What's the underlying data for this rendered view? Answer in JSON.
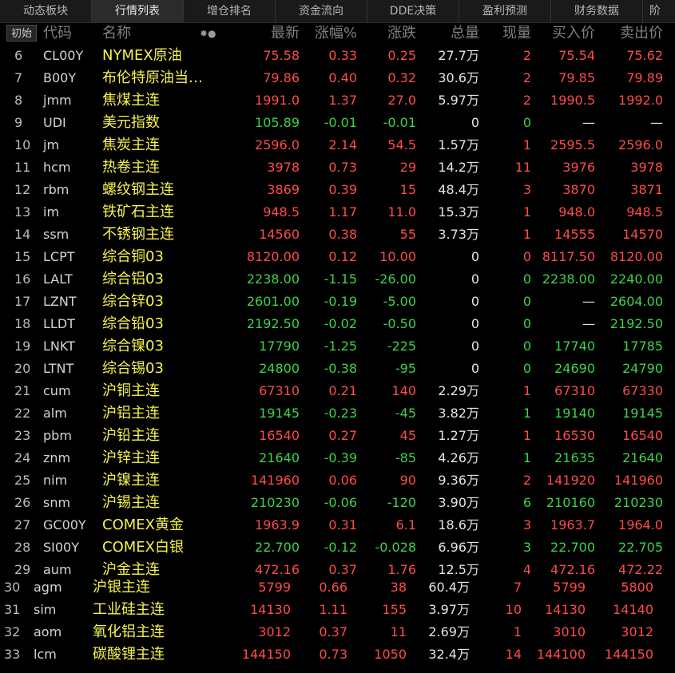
{
  "tabs": [
    "动态板块",
    "行情列表",
    "增仓排名",
    "资金流向",
    "DDE决策",
    "盈利预测",
    "财务数据",
    "阶"
  ],
  "active_tab": 1,
  "init_button": "初始",
  "columns": {
    "code": "代码",
    "name": "名称",
    "icons": "✸●",
    "last": "最新",
    "pct": "涨幅%",
    "change": "涨跌",
    "volume": "总量",
    "cur": "现量",
    "bid": "买入价",
    "ask": "卖出价"
  },
  "rows": [
    {
      "idx": "6",
      "code": "CL00Y",
      "name": "NYMEX原油",
      "last": "75.58",
      "pct": "0.33",
      "change": "0.25",
      "volume": "27.7万",
      "cur": "2",
      "bid": "75.54",
      "ask": "75.62",
      "dir": "red"
    },
    {
      "idx": "7",
      "code": "B00Y",
      "name": "布伦特原油当…",
      "last": "79.86",
      "pct": "0.40",
      "change": "0.32",
      "volume": "30.6万",
      "cur": "2",
      "bid": "79.85",
      "ask": "79.89",
      "dir": "red"
    },
    {
      "idx": "8",
      "code": "jmm",
      "name": "焦煤主连",
      "last": "1991.0",
      "pct": "1.37",
      "change": "27.0",
      "volume": "5.97万",
      "cur": "2",
      "bid": "1990.5",
      "ask": "1992.0",
      "dir": "red"
    },
    {
      "idx": "9",
      "code": "UDI",
      "name": "美元指数",
      "last": "105.89",
      "pct": "-0.01",
      "change": "-0.01",
      "volume": "0",
      "cur": "0",
      "bid": "—",
      "ask": "—",
      "dir": "green"
    },
    {
      "idx": "10",
      "code": "jm",
      "name": "焦炭主连",
      "last": "2596.0",
      "pct": "2.14",
      "change": "54.5",
      "volume": "1.57万",
      "cur": "1",
      "bid": "2595.5",
      "ask": "2596.0",
      "dir": "red"
    },
    {
      "idx": "11",
      "code": "hcm",
      "name": "热卷主连",
      "last": "3978",
      "pct": "0.73",
      "change": "29",
      "volume": "14.2万",
      "cur": "11",
      "bid": "3976",
      "ask": "3978",
      "dir": "red"
    },
    {
      "idx": "12",
      "code": "rbm",
      "name": "螺纹钢主连",
      "last": "3869",
      "pct": "0.39",
      "change": "15",
      "volume": "48.4万",
      "cur": "3",
      "bid": "3870",
      "ask": "3871",
      "dir": "red"
    },
    {
      "idx": "13",
      "code": "im",
      "name": "铁矿石主连",
      "last": "948.5",
      "pct": "1.17",
      "change": "11.0",
      "volume": "15.3万",
      "cur": "1",
      "bid": "948.0",
      "ask": "948.5",
      "dir": "red"
    },
    {
      "idx": "14",
      "code": "ssm",
      "name": "不锈钢主连",
      "last": "14560",
      "pct": "0.38",
      "change": "55",
      "volume": "3.73万",
      "cur": "1",
      "bid": "14555",
      "ask": "14570",
      "dir": "red"
    },
    {
      "idx": "15",
      "code": "LCPT",
      "name": "综合铜03",
      "last": "8120.00",
      "pct": "0.12",
      "change": "10.00",
      "volume": "0",
      "cur": "0",
      "bid": "8117.50",
      "ask": "8120.00",
      "dir": "red"
    },
    {
      "idx": "16",
      "code": "LALT",
      "name": "综合铝03",
      "last": "2238.00",
      "pct": "-1.15",
      "change": "-26.00",
      "volume": "0",
      "cur": "0",
      "bid": "2238.00",
      "ask": "2240.00",
      "dir": "green"
    },
    {
      "idx": "17",
      "code": "LZNT",
      "name": "综合锌03",
      "last": "2601.00",
      "pct": "-0.19",
      "change": "-5.00",
      "volume": "0",
      "cur": "0",
      "bid": "—",
      "ask": "2604.00",
      "dir": "green"
    },
    {
      "idx": "18",
      "code": "LLDT",
      "name": "综合铅03",
      "last": "2192.50",
      "pct": "-0.02",
      "change": "-0.50",
      "volume": "0",
      "cur": "0",
      "bid": "—",
      "ask": "2192.50",
      "dir": "green"
    },
    {
      "idx": "19",
      "code": "LNKT",
      "name": "综合镍03",
      "last": "17790",
      "pct": "-1.25",
      "change": "-225",
      "volume": "0",
      "cur": "0",
      "bid": "17740",
      "ask": "17785",
      "dir": "green"
    },
    {
      "idx": "20",
      "code": "LTNT",
      "name": "综合锡03",
      "last": "24800",
      "pct": "-0.38",
      "change": "-95",
      "volume": "0",
      "cur": "0",
      "bid": "24690",
      "ask": "24790",
      "dir": "green"
    },
    {
      "idx": "21",
      "code": "cum",
      "name": "沪铜主连",
      "last": "67310",
      "pct": "0.21",
      "change": "140",
      "volume": "2.29万",
      "cur": "1",
      "bid": "67310",
      "ask": "67330",
      "dir": "red"
    },
    {
      "idx": "22",
      "code": "alm",
      "name": "沪铝主连",
      "last": "19145",
      "pct": "-0.23",
      "change": "-45",
      "volume": "3.82万",
      "cur": "1",
      "bid": "19140",
      "ask": "19145",
      "dir": "green"
    },
    {
      "idx": "23",
      "code": "pbm",
      "name": "沪铅主连",
      "last": "16540",
      "pct": "0.27",
      "change": "45",
      "volume": "1.27万",
      "cur": "1",
      "bid": "16530",
      "ask": "16540",
      "dir": "red"
    },
    {
      "idx": "24",
      "code": "znm",
      "name": "沪锌主连",
      "last": "21640",
      "pct": "-0.39",
      "change": "-85",
      "volume": "4.26万",
      "cur": "1",
      "bid": "21635",
      "ask": "21640",
      "dir": "green"
    },
    {
      "idx": "25",
      "code": "nim",
      "name": "沪镍主连",
      "last": "141960",
      "pct": "0.06",
      "change": "90",
      "volume": "9.36万",
      "cur": "2",
      "bid": "141920",
      "ask": "141960",
      "dir": "red"
    },
    {
      "idx": "26",
      "code": "snm",
      "name": "沪锡主连",
      "last": "210230",
      "pct": "-0.06",
      "change": "-120",
      "volume": "3.90万",
      "cur": "6",
      "bid": "210160",
      "ask": "210230",
      "dir": "green"
    },
    {
      "idx": "27",
      "code": "GC00Y",
      "name": "COMEX黄金",
      "last": "1963.9",
      "pct": "0.31",
      "change": "6.1",
      "volume": "18.6万",
      "cur": "3",
      "bid": "1963.7",
      "ask": "1964.0",
      "dir": "red"
    },
    {
      "idx": "28",
      "code": "SI00Y",
      "name": "COMEX白银",
      "last": "22.700",
      "pct": "-0.12",
      "change": "-0.028",
      "volume": "6.96万",
      "cur": "3",
      "bid": "22.700",
      "ask": "22.705",
      "dir": "green"
    },
    {
      "idx": "29",
      "code": "aum",
      "name": "沪金主连",
      "last": "472.16",
      "pct": "0.37",
      "change": "1.76",
      "volume": "12.5万",
      "cur": "4",
      "bid": "472.16",
      "ask": "472.22",
      "dir": "red"
    }
  ],
  "inset_rows": [
    {
      "idx": "30",
      "code": "agm",
      "name": "沪银主连",
      "last": "5799",
      "pct": "0.66",
      "change": "38",
      "volume": "60.4万",
      "cur": "7",
      "bid": "5799",
      "ask": "5800",
      "dir": "red"
    },
    {
      "idx": "31",
      "code": "sim",
      "name": "工业硅主连",
      "last": "14130",
      "pct": "1.11",
      "change": "155",
      "volume": "3.97万",
      "cur": "10",
      "bid": "14130",
      "ask": "14140",
      "dir": "red"
    },
    {
      "idx": "32",
      "code": "aom",
      "name": "氧化铝主连",
      "last": "3012",
      "pct": "0.37",
      "change": "11",
      "volume": "2.69万",
      "cur": "1",
      "bid": "3010",
      "ask": "3012",
      "dir": "red"
    },
    {
      "idx": "33",
      "code": "lcm",
      "name": "碳酸锂主连",
      "last": "144150",
      "pct": "0.73",
      "change": "1050",
      "volume": "32.4万",
      "cur": "14",
      "bid": "144100",
      "ask": "144150",
      "dir": "red"
    }
  ],
  "colors": {
    "up": "#ff4b4b",
    "down": "#3dd34a",
    "name": "#f5f24c",
    "header": "#7f7f7f"
  }
}
